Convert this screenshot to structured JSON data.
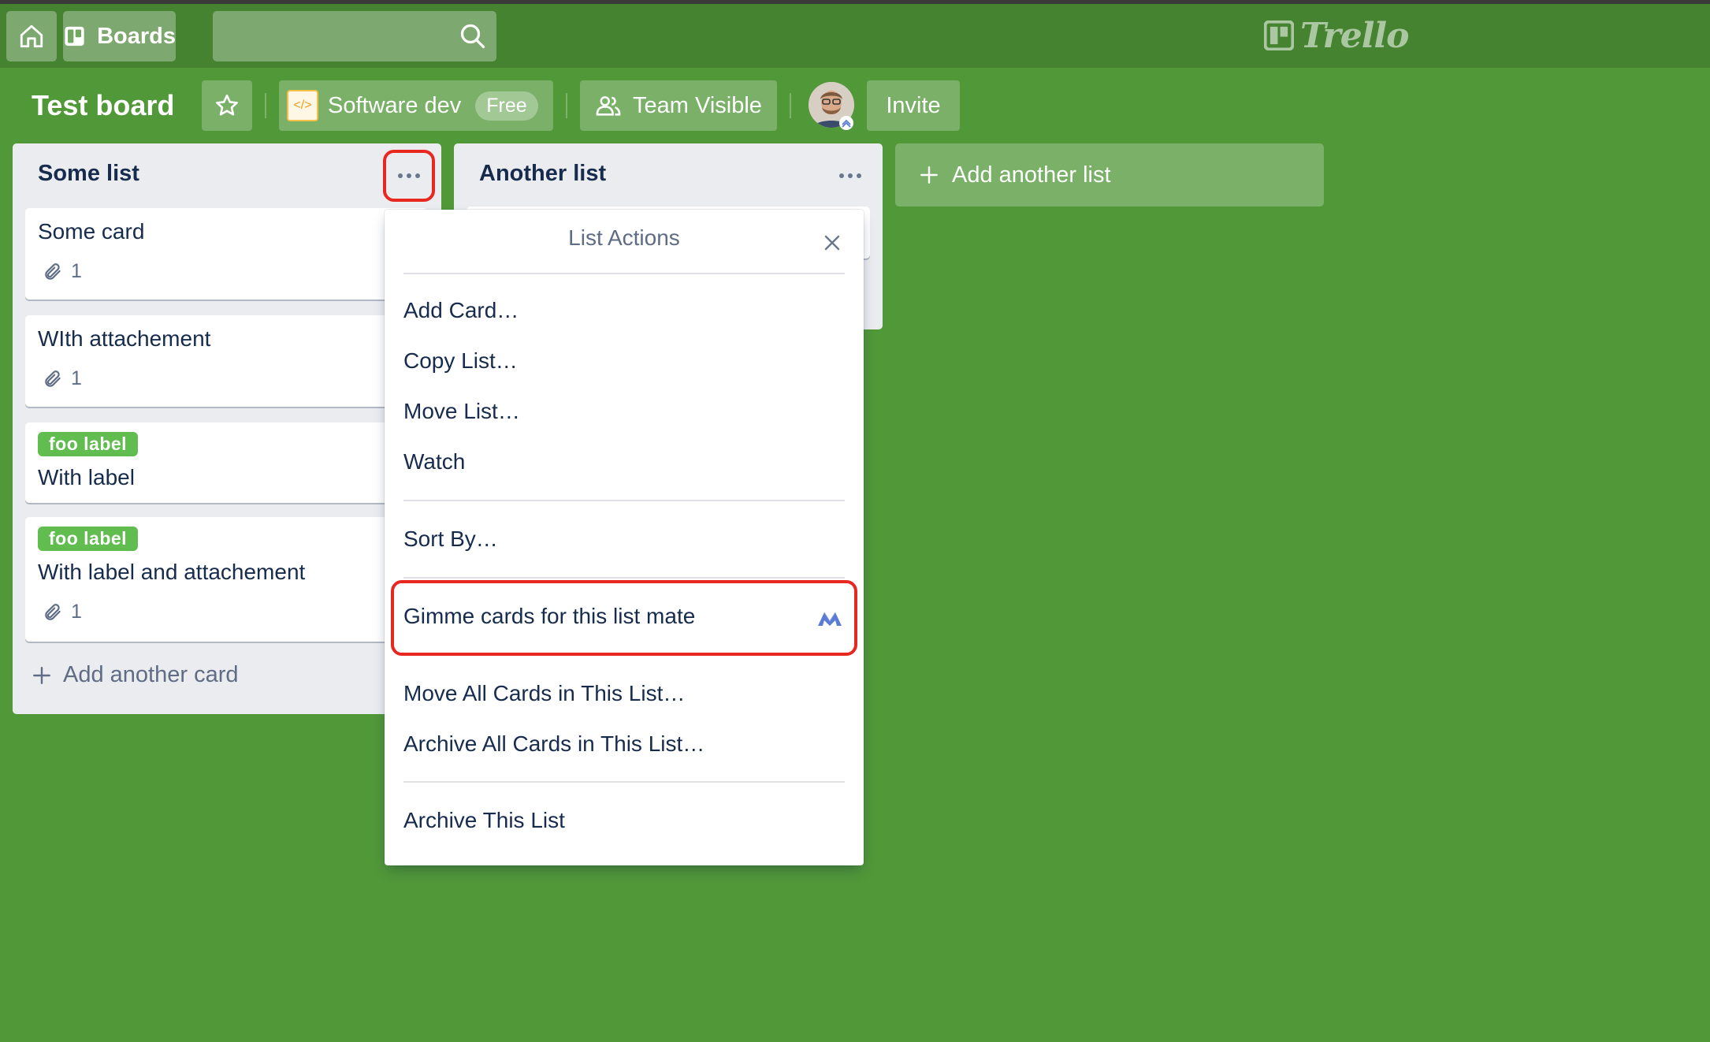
{
  "topbar": {
    "boards_label": "Boards",
    "logo_text": "Trello"
  },
  "board": {
    "title": "Test board",
    "team_name": "Software dev",
    "team_plan": "Free",
    "visibility": "Team Visible",
    "invite_label": "Invite"
  },
  "lists": [
    {
      "title": "Some list",
      "cards": [
        {
          "title": "Some card",
          "attachments": "1"
        },
        {
          "title": "WIth attachement",
          "attachments": "1"
        },
        {
          "label": "foo label",
          "title": "With label"
        },
        {
          "label": "foo label",
          "title": "With label and attachement",
          "attachments": "1"
        }
      ],
      "add_card_label": "Add another card"
    },
    {
      "title": "Another list"
    }
  ],
  "add_list_label": "Add another list",
  "list_actions": {
    "title": "List Actions",
    "items": [
      "Add Card…",
      "Copy List…",
      "Move List…",
      "Watch",
      "Sort By…",
      "Gimme cards for this list mate",
      "Move All Cards in This List…",
      "Archive All Cards in This List…",
      "Archive This List"
    ]
  },
  "colors": {
    "board_background": "#519839",
    "label_green": "#61bd4f",
    "highlight_red": "#e8281e"
  }
}
